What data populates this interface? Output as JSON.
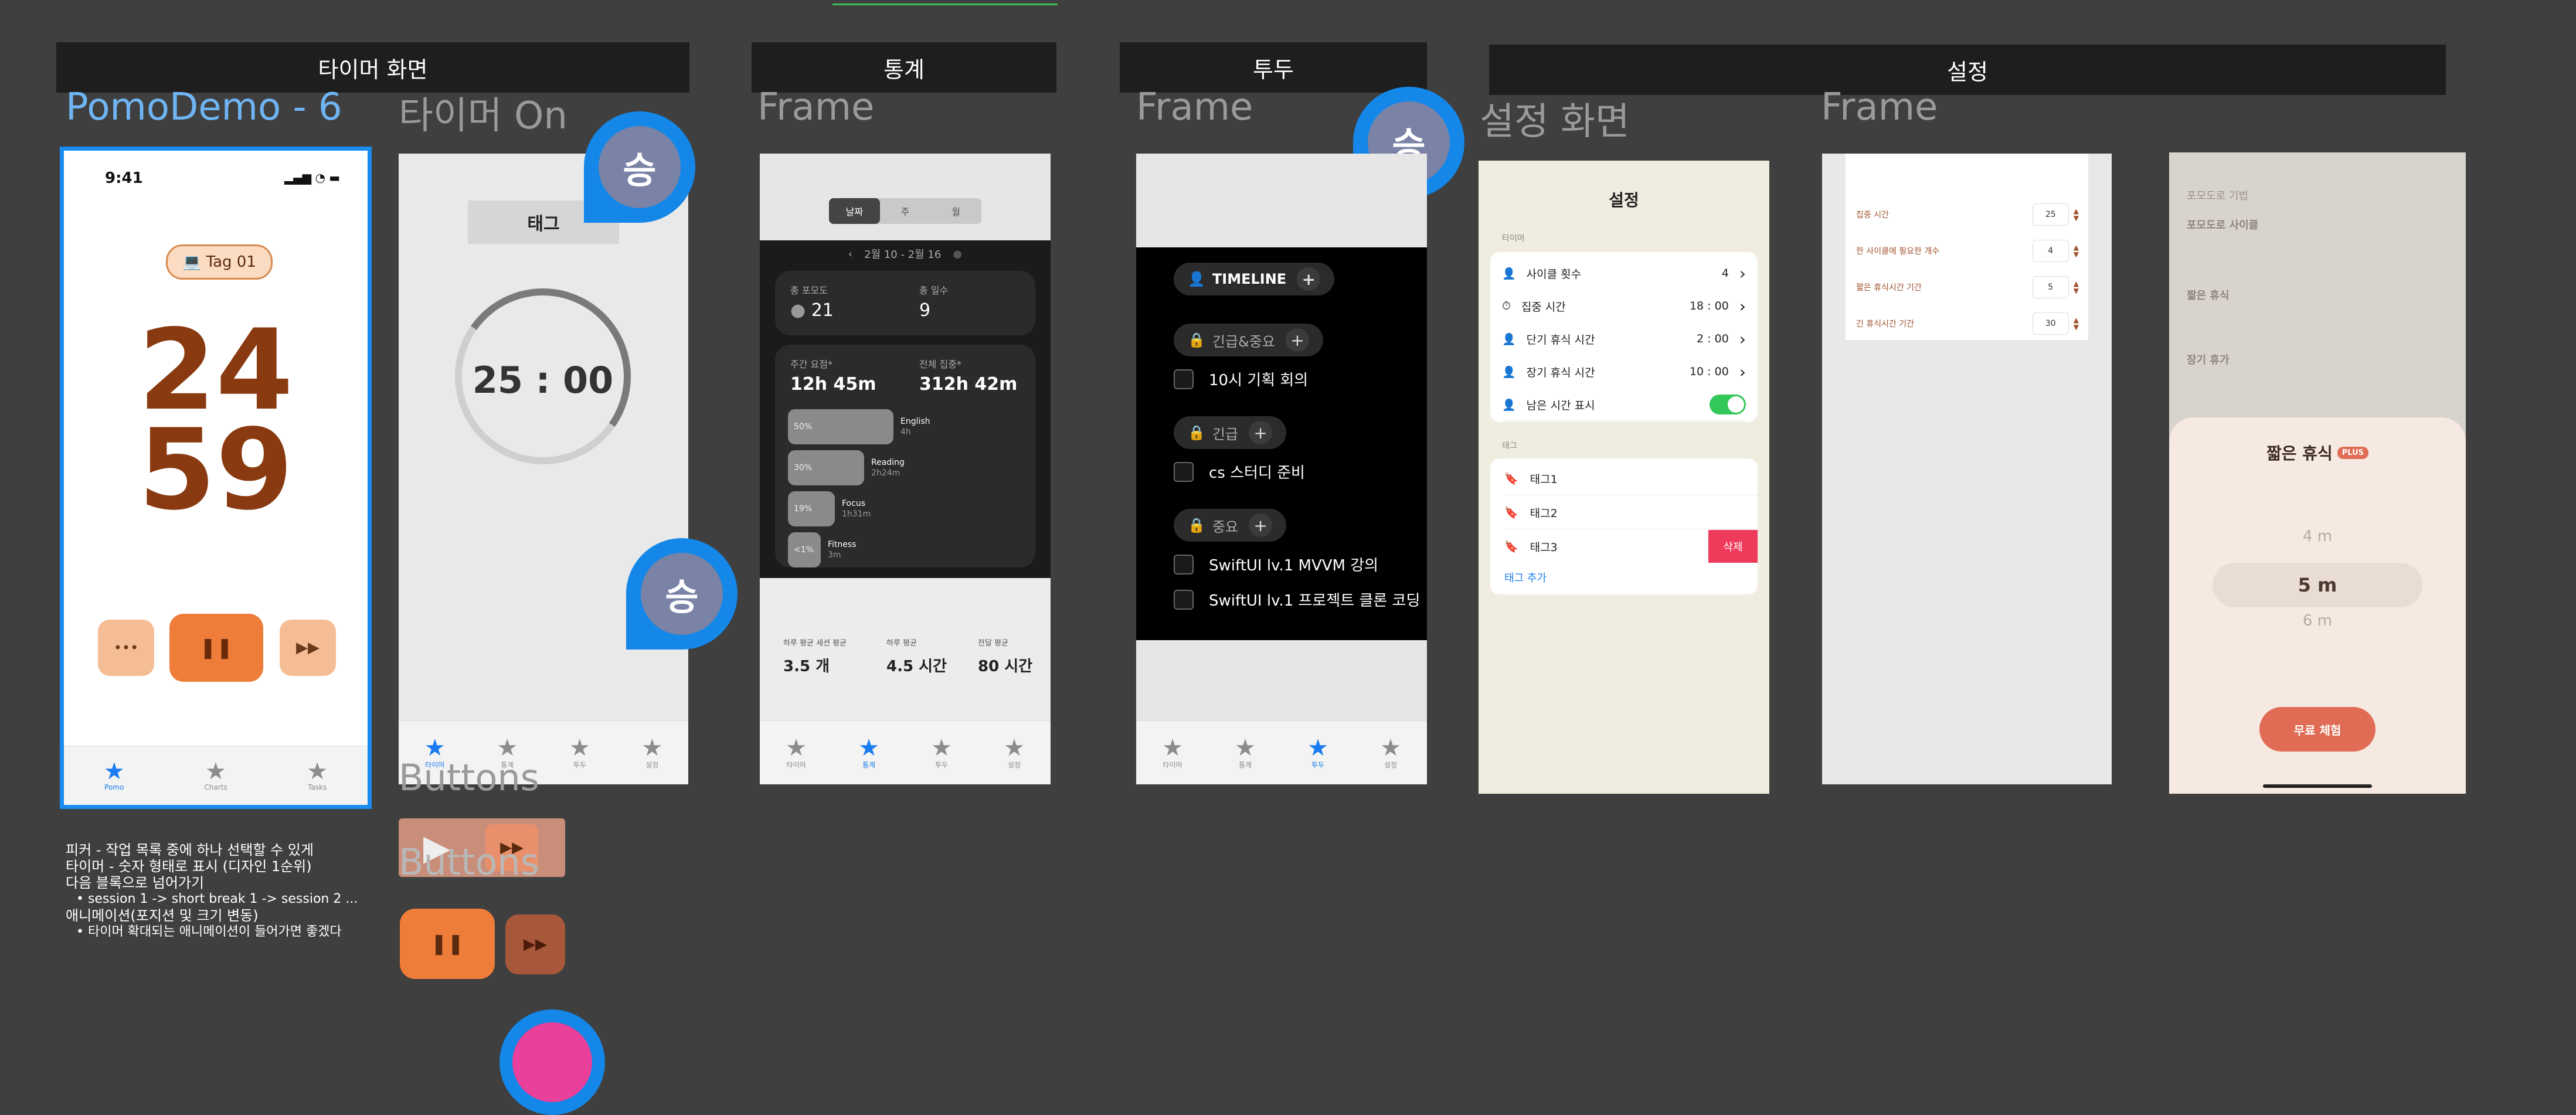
{
  "sections": {
    "timer": "타이머 화면",
    "stats": "통계",
    "todo": "투두",
    "settings": "설정"
  },
  "frame_labels": {
    "pomodemo": "PomoDemo - 6",
    "timer_on": "타이머 On",
    "stats_frame": "Frame",
    "todo_frame": "Frame",
    "settings_screen": "설정 화면",
    "settings_frame": "Frame"
  },
  "avatar_initial": "승",
  "pomodemo": {
    "time": "9:41",
    "tag": "Tag 01",
    "minutes": "24",
    "seconds": "59",
    "more": "•••",
    "pause": "❚❚",
    "skip": "▶▶",
    "tabs": [
      "Pomo",
      "Charts",
      "Tasks"
    ]
  },
  "timer_on": {
    "tag": "태그",
    "timer": "25 : 00",
    "tabs": [
      "타이머",
      "통계",
      "투두",
      "설정"
    ]
  },
  "buttons_label": "Buttons",
  "buttons_label2": "Buttons",
  "stats": {
    "segments": [
      "날짜",
      "주",
      "월"
    ],
    "range": "2월 10 - 2월 16",
    "pomodoro_label": "총 포모도",
    "pomodoro_value": "21",
    "days_label": "총 일수",
    "days_value": "9",
    "weekly_label": "주간 요점*",
    "weekly_value": "12h 45m",
    "total_label": "전체 집중*",
    "total_value": "312h 42m",
    "bars": [
      {
        "pct": "50%",
        "name": "English",
        "time": "4h"
      },
      {
        "pct": "30%",
        "name": "Reading",
        "time": "2h24m"
      },
      {
        "pct": "19%",
        "name": "Focus",
        "time": "1h31m"
      },
      {
        "pct": "<1%",
        "name": "Fitness",
        "time": "3m"
      }
    ],
    "footer": [
      {
        "label": "하루 평균 세션 평균",
        "value": "3.5 개"
      },
      {
        "label": "하루 평균",
        "value": "4.5 시간"
      },
      {
        "label": "전달 평균",
        "value": "80 시간"
      }
    ],
    "tabs": [
      "타이머",
      "통계",
      "투두",
      "설정"
    ]
  },
  "todo": {
    "timeline": "TIMELINE",
    "groups": [
      {
        "label": "긴급&중요",
        "items": [
          "10시 기획 회의"
        ]
      },
      {
        "label": "긴급",
        "items": [
          "cs 스터디 준비"
        ]
      },
      {
        "label": "중요",
        "items": [
          "SwiftUI lv.1 MVVM 강의",
          "SwiftUI lv.1 프로젝트 클론 코딩"
        ]
      }
    ],
    "tabs": [
      "타이머",
      "통계",
      "투두",
      "설정"
    ]
  },
  "settings": {
    "title": "설정",
    "section_timer": "타이머",
    "rows": [
      {
        "label": "사이클 횟수",
        "value": "4"
      },
      {
        "label": "집중 시간",
        "value": "18 : 00"
      },
      {
        "label": "단기 휴식 시간",
        "value": "2 : 00"
      },
      {
        "label": "장기 휴식 시간",
        "value": "10 : 00"
      },
      {
        "label": "남은 시간 표시",
        "value": ""
      }
    ],
    "section_tag": "태그",
    "tags": [
      "태그1",
      "태그2",
      "태그3"
    ],
    "delete": "삭제",
    "add_tag": "태그 추가"
  },
  "settings_frame": {
    "rows": [
      {
        "label": "집중 시간",
        "value": "25"
      },
      {
        "label": "한 사이클에 필요한 개수",
        "value": "4"
      },
      {
        "label": "짧은 휴식시간 기간",
        "value": "5"
      },
      {
        "label": "긴 휴식시간 기간",
        "value": "30"
      }
    ]
  },
  "sheet": {
    "bg_title": "포모도로 기법",
    "bg_items": [
      "포모도로 사이클",
      "짧은 휴식",
      "장기 휴가"
    ],
    "title": "짧은 휴식",
    "badge": "PLUS",
    "options": [
      "4 m",
      "5 m",
      "6 m"
    ],
    "cta": "무료 체험"
  },
  "notes": [
    "피커 - 작업 목록 중에 하나 선택할 수 있게",
    "타이머 - 숫자 형태로 표시 (디자인 1순위)",
    "다음 블록으로 넘어가기",
    "• session 1 -> short break 1 -> session 2 ...",
    "애니메이션(포지션 및 크기 변동)",
    "• 타이머 확대되는 애니메이션이 들어가면 좋겠다"
  ],
  "colors": {
    "accent_blue": "#1a7cf0",
    "timer_brown": "#8a3a10",
    "button_orange": "#ef7d3a",
    "button_peach": "#f5bd95",
    "toggle_green": "#34c759",
    "delete_red": "#ef3b5b",
    "cta_coral": "#e06c55"
  }
}
